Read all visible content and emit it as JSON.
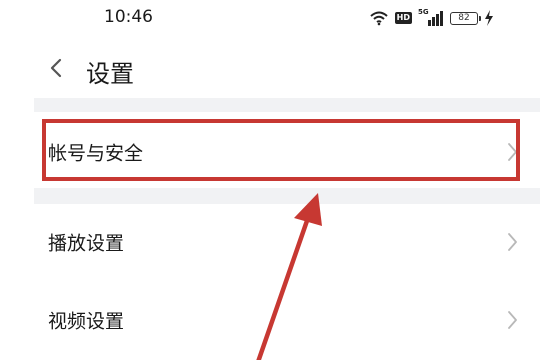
{
  "status_bar": {
    "time": "10:46",
    "network_label": "5G",
    "hd_label": "HD",
    "battery_level": "82",
    "icons": [
      "wifi-icon",
      "hd-icon",
      "signal-5g-icon",
      "battery-icon",
      "charging-icon"
    ]
  },
  "header": {
    "back_icon": "chevron-left-icon",
    "title": "设置"
  },
  "settings": {
    "items": [
      {
        "label": "帐号与安全",
        "icon": "chevron-right-icon",
        "highlighted": true
      },
      {
        "label": "播放设置",
        "icon": "chevron-right-icon",
        "highlighted": false
      },
      {
        "label": "视频设置",
        "icon": "chevron-right-icon",
        "highlighted": false
      }
    ]
  },
  "annotation": {
    "color": "#c73832",
    "target": "帐号与安全"
  },
  "colors": {
    "background": "#ffffff",
    "divider": "#f1f2f4",
    "text": "#1a1a1a",
    "chevron": "#b8b8b8",
    "highlight": "#c73832"
  }
}
